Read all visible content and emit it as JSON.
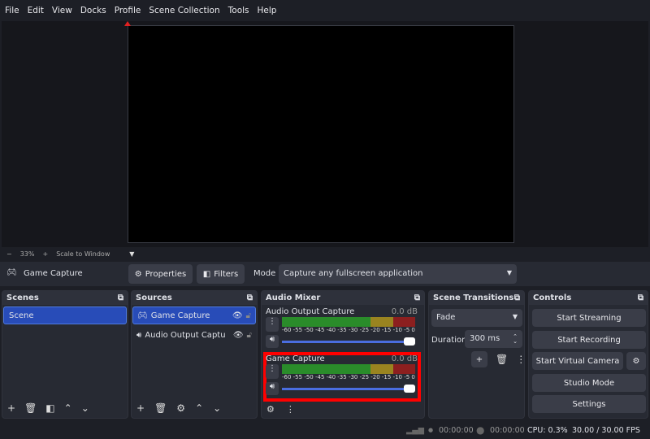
{
  "menu": [
    "File",
    "Edit",
    "View",
    "Docks",
    "Profile",
    "Scene Collection",
    "Tools",
    "Help"
  ],
  "zoom": {
    "minus": "−",
    "level": "33%",
    "plus": "+",
    "mode": "Scale to Window"
  },
  "source_toolbar": {
    "source_name": "Game Capture",
    "properties": "Properties",
    "filters": "Filters",
    "mode_label": "Mode",
    "mode_value": "Capture any fullscreen application"
  },
  "scenes": {
    "title": "Scenes",
    "items": [
      "Scene"
    ]
  },
  "sources": {
    "title": "Sources",
    "items": [
      "Game Capture",
      "Audio Output Captu"
    ]
  },
  "mixer": {
    "title": "Audio Mixer",
    "ticks": [
      "-60",
      "-55",
      "-50",
      "-45",
      "-40",
      "-35",
      "-30",
      "-25",
      "-20",
      "-15",
      "-10",
      "-5",
      "0"
    ],
    "channels": [
      {
        "name": "Audio Output Capture",
        "db": "0.0 dB",
        "volume": 1.0
      },
      {
        "name": "Game Capture",
        "db": "0.0 dB",
        "volume": 1.0,
        "highlighted": true
      }
    ],
    "highlight_color": "#ff0000"
  },
  "transitions": {
    "title": "Scene Transitions",
    "type": "Fade",
    "duration_label": "Duration",
    "duration": "300 ms"
  },
  "controls": {
    "title": "Controls",
    "start_streaming": "Start Streaming",
    "start_recording": "Start Recording",
    "start_virtual_camera": "Start Virtual Camera",
    "studio_mode": "Studio Mode",
    "settings": "Settings"
  },
  "status": {
    "stream_time": "00:00:00",
    "record_time": "00:00:00",
    "cpu": "CPU: 0.3%",
    "fps": "30.00 / 30.00 FPS"
  }
}
